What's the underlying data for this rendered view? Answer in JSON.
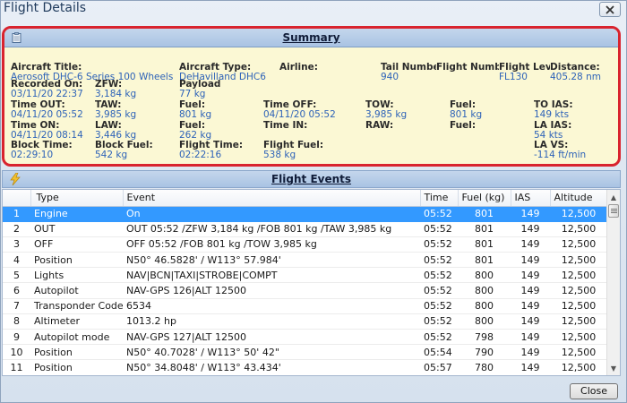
{
  "window": {
    "title": "Flight Details"
  },
  "summary": {
    "title": "Summary",
    "fields": [
      {
        "label": "Aircraft Title:",
        "value": "Aerosoft DHC-6 Series 100 Wheels"
      },
      {
        "label": "Aircraft Type:",
        "value": "DeHavilland DHC6"
      },
      {
        "label": "Airline:",
        "value": ""
      },
      {
        "label": "Tail Number:",
        "value": "940"
      },
      {
        "label": "Flight Number:",
        "value": ""
      },
      {
        "label": "Flight Level:",
        "value": "FL130"
      },
      {
        "label": "Distance:",
        "value": "405.28 nm"
      },
      {
        "label": "Recorded On:",
        "value": "03/11/20 22:37"
      },
      {
        "label": "ZFW:",
        "value": "3,184 kg"
      },
      {
        "label": "Payload",
        "value": "77 kg"
      },
      {
        "label": "Time OUT:",
        "value": "04/11/20 05:52"
      },
      {
        "label": "TAW:",
        "value": "3,985 kg"
      },
      {
        "label": "Fuel:",
        "value": "801 kg"
      },
      {
        "label": "Time OFF:",
        "value": "04/11/20 05:52"
      },
      {
        "label": "TOW:",
        "value": "3,985 kg"
      },
      {
        "label": "Fuel:",
        "value": "801 kg"
      },
      {
        "label": "TO IAS:",
        "value": "149 kts"
      },
      {
        "label": "Time ON:",
        "value": "04/11/20 08:14"
      },
      {
        "label": "LAW:",
        "value": "3,446 kg"
      },
      {
        "label": "Fuel:",
        "value": "262 kg"
      },
      {
        "label": "Time IN:",
        "value": ""
      },
      {
        "label": "RAW:",
        "value": ""
      },
      {
        "label": "Fuel:",
        "value": ""
      },
      {
        "label": "LA IAS:",
        "value": "54 kts"
      },
      {
        "label": "Block Time:",
        "value": "02:29:10"
      },
      {
        "label": "Block Fuel:",
        "value": "542 kg"
      },
      {
        "label": "Flight Time:",
        "value": "02:22:16"
      },
      {
        "label": "Flight Fuel:",
        "value": "538 kg"
      },
      {
        "label": "LA VS:",
        "value": "-114 ft/min"
      }
    ]
  },
  "events": {
    "title": "Flight Events",
    "columns": [
      "",
      "Type",
      "Event",
      "Time",
      "Fuel (kg)",
      "IAS",
      "Altitude"
    ],
    "rows": [
      {
        "n": "1",
        "type": "Engine",
        "event": "On",
        "time": "05:52",
        "fuel": "801",
        "ias": "149",
        "alt": "12,500"
      },
      {
        "n": "2",
        "type": "OUT",
        "event": "OUT 05:52 /ZFW 3,184 kg /FOB 801 kg /TAW 3,985 kg",
        "time": "05:52",
        "fuel": "801",
        "ias": "149",
        "alt": "12,500"
      },
      {
        "n": "3",
        "type": "OFF",
        "event": "OFF 05:52 /FOB 801 kg /TOW 3,985 kg",
        "time": "05:52",
        "fuel": "801",
        "ias": "149",
        "alt": "12,500"
      },
      {
        "n": "4",
        "type": "Position",
        "event": "N50° 46.5828' / W113° 57.984'",
        "time": "05:52",
        "fuel": "801",
        "ias": "149",
        "alt": "12,500"
      },
      {
        "n": "5",
        "type": "Lights",
        "event": "NAV|BCN|TAXI|STROBE|COMPT",
        "time": "05:52",
        "fuel": "800",
        "ias": "149",
        "alt": "12,500"
      },
      {
        "n": "6",
        "type": "Autopilot",
        "event": "NAV-GPS 126|ALT 12500",
        "time": "05:52",
        "fuel": "800",
        "ias": "149",
        "alt": "12,500"
      },
      {
        "n": "7",
        "type": "Transponder Code",
        "event": "6534",
        "time": "05:52",
        "fuel": "800",
        "ias": "149",
        "alt": "12,500"
      },
      {
        "n": "8",
        "type": "Altimeter",
        "event": "1013.2 hp",
        "time": "05:52",
        "fuel": "800",
        "ias": "149",
        "alt": "12,500"
      },
      {
        "n": "9",
        "type": "Autopilot mode",
        "event": "NAV-GPS 127|ALT 12500",
        "time": "05:52",
        "fuel": "798",
        "ias": "149",
        "alt": "12,500"
      },
      {
        "n": "10",
        "type": "Position",
        "event": "N50° 40.7028' / W113° 50' 42\"",
        "time": "05:54",
        "fuel": "790",
        "ias": "149",
        "alt": "12,500"
      },
      {
        "n": "11",
        "type": "Position",
        "event": "N50° 34.8048' / W113° 43.434'",
        "time": "05:57",
        "fuel": "780",
        "ias": "149",
        "alt": "12,500"
      }
    ]
  },
  "footer": {
    "close_label": "Close"
  },
  "icons": {
    "window_close": "close-icon",
    "summary": "clipboard-icon",
    "events": "lightning-icon"
  },
  "colors": {
    "highlight_border": "#d9232e",
    "selection": "#3399ff",
    "value_text": "#2d62b8",
    "summary_bg": "#fbf8d4"
  }
}
